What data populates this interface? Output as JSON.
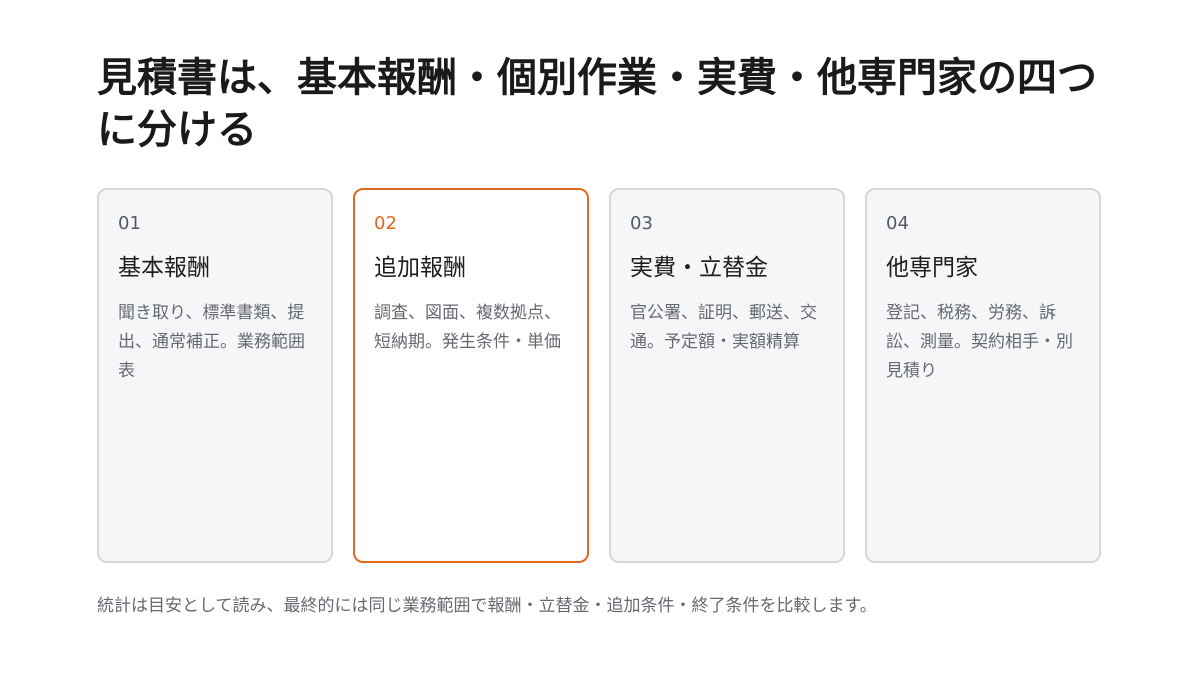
{
  "title": "見積書は、基本報酬・個別作業・実費・他専門家の四つに分ける",
  "cards": [
    {
      "number": "01",
      "title": "基本報酬",
      "description": "聞き取り、標準書類、提出、通常補正。業務範囲表"
    },
    {
      "number": "02",
      "title": "追加報酬",
      "description": "調査、図面、複数拠点、短納期。発生条件・単価"
    },
    {
      "number": "03",
      "title": "実費・立替金",
      "description": "官公署、証明、郵送、交通。予定額・実額精算"
    },
    {
      "number": "04",
      "title": "他専門家",
      "description": "登記、税務、労務、訴訟、測量。契約相手・別見積り"
    }
  ],
  "footnote": "統計は目安として読み、最終的には同じ業務範囲で報酬・立替金・追加条件・終了条件を比較します。",
  "colors": {
    "accent": "#e0681f",
    "card_background": "#f5f6f8",
    "card_border": "#d6d7db"
  }
}
